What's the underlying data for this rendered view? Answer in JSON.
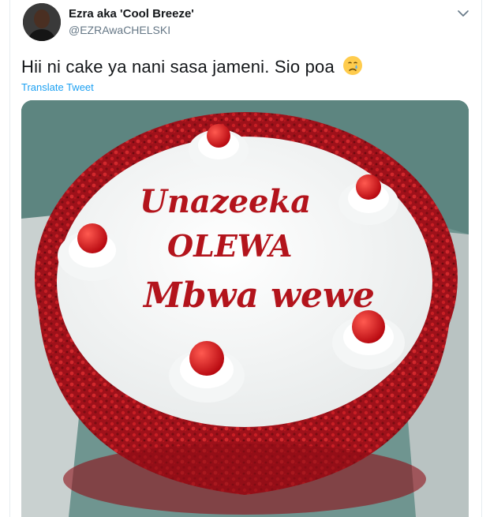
{
  "tweet": {
    "display_name": "Ezra aka 'Cool Breeze'",
    "handle": "@EZRAwaCHELSKI",
    "text": "Hii ni cake ya nani sasa jameni. Sio poa",
    "emoji": "crying-face",
    "translate_label": "Translate Tweet"
  },
  "media": {
    "cake_lines": [
      "Unazeeka",
      "OLEWA",
      "Mbwa wewe"
    ]
  },
  "colors": {
    "link": "#1da1f2",
    "secondary_text": "#657786",
    "icing": "#b3141c",
    "crumb": "#a8121a"
  }
}
